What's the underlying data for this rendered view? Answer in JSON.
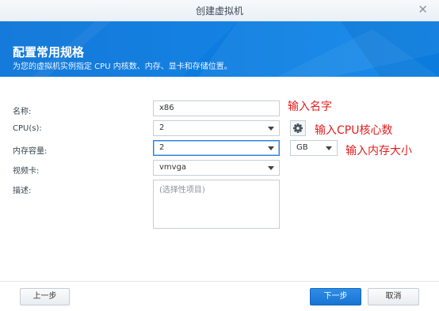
{
  "window": {
    "title": "创建虚拟机",
    "close_glyph": "✕"
  },
  "banner": {
    "heading": "配置常用规格",
    "subtitle": "为您的虚拟机实例指定 CPU 内核数、内存、显卡和存储位置。"
  },
  "form": {
    "name": {
      "label": "名称:",
      "value": "x86"
    },
    "cpu": {
      "label": "CPU(s):",
      "value": "2"
    },
    "memory": {
      "label": "内存容量:",
      "value": "2",
      "unit": "GB"
    },
    "video": {
      "label": "视频卡:",
      "value": "vmvga"
    },
    "description": {
      "label": "描述:",
      "placeholder": "(选择性项目)"
    }
  },
  "annotations": {
    "name_hint": "输入名字",
    "cpu_hint": "输入CPU核心数",
    "memory_hint": "输入内存大小"
  },
  "footer": {
    "prev": "上一步",
    "next": "下一步",
    "cancel": "取消"
  },
  "colors": {
    "banner": "#0d80e4",
    "annotation": "#e01e1e",
    "primary_button": "#1874d2"
  }
}
